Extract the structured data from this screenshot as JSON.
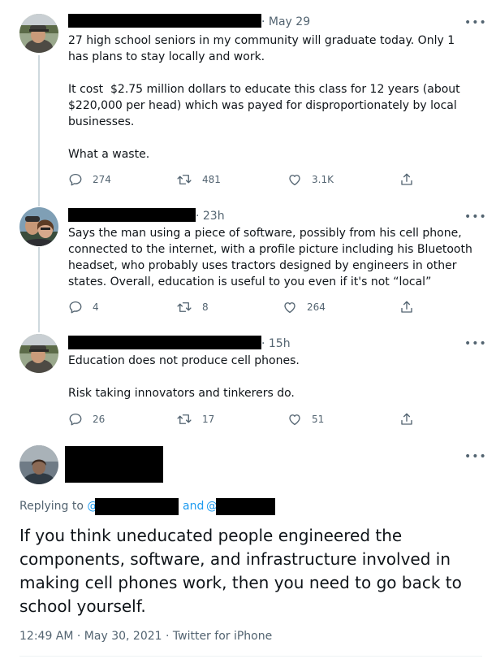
{
  "tweets": [
    {
      "time": "· May 29",
      "text": "27 high school seniors in my community will graduate today. Only 1 has plans to stay locally and work.\n\nIt cost  $2.75 million dollars to educate this class for 12 years (about $220,000 per head) which was payed for disproportionately by local businesses.\n\nWhat a waste.",
      "replies": "274",
      "retweets": "481",
      "likes": "3.1K"
    },
    {
      "time": "· 23h",
      "text": "Says the man using a piece of software, possibly from his cell phone, connected to the internet, with a profile picture including his Bluetooth headset, who probably uses tractors designed by engineers in other states. Overall, education is useful to you even if it's not “local”",
      "replies": "4",
      "retweets": "8",
      "likes": "264"
    },
    {
      "time": "· 15h",
      "text": "Education does not produce cell phones.\n\nRisk taking innovators and tinkerers do.",
      "replies": "26",
      "retweets": "17",
      "likes": "51"
    }
  ],
  "main": {
    "replying_prefix": "Replying to",
    "at_sign_1": "@",
    "and_text": "and",
    "at_sign_2": "@",
    "text": "If you think uneducated people engineered the components, software, and infrastructure involved in making cell phones work, then you need to go back to school yourself.",
    "meta": "12:49 AM · May 30, 2021 · Twitter for iPhone"
  },
  "icons": {
    "more": "more-dots-icon",
    "reply": "reply-bubble-icon",
    "retweet": "retweet-icon",
    "like": "heart-icon",
    "share": "share-icon"
  },
  "colors": {
    "text": "#0f1419",
    "secondary": "#536471",
    "link": "#1d9bf0",
    "thread_line": "#cfd9de"
  }
}
